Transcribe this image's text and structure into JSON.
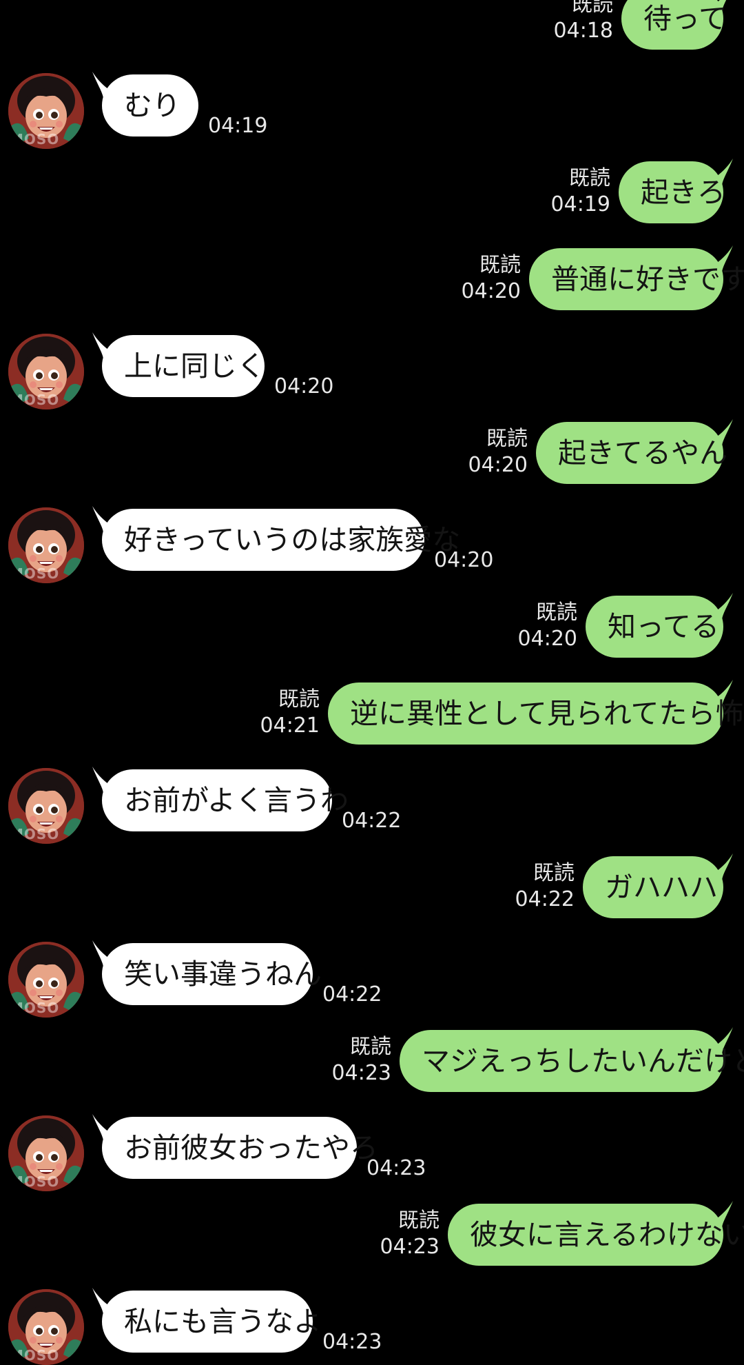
{
  "colors": {
    "background": "#000000",
    "outgoing_bubble": "#9fe184",
    "incoming_bubble": "#ffffff",
    "meta_text": "#e8e8e8"
  },
  "avatar": {
    "icon": "avatar-cartoon-girl-icon",
    "watermark": "MOSO"
  },
  "messages": [
    {
      "side": "out",
      "text": "待って",
      "read": "既読",
      "time": "04:18"
    },
    {
      "side": "in",
      "text": "むり",
      "time": "04:19"
    },
    {
      "side": "out",
      "text": "起きろ",
      "read": "既読",
      "time": "04:19"
    },
    {
      "side": "out",
      "text": "普通に好きです",
      "read": "既読",
      "time": "04:20"
    },
    {
      "side": "in",
      "text": "上に同じく",
      "time": "04:20"
    },
    {
      "side": "out",
      "text": "起きてるやん",
      "read": "既読",
      "time": "04:20"
    },
    {
      "side": "in",
      "text": "好きっていうのは家族愛な",
      "time": "04:20"
    },
    {
      "side": "out",
      "text": "知ってる",
      "read": "既読",
      "time": "04:20"
    },
    {
      "side": "out",
      "text": "逆に異性として見られてたら怖い",
      "read": "既読",
      "time": "04:21"
    },
    {
      "side": "in",
      "text": "お前がよく言うわ",
      "time": "04:22"
    },
    {
      "side": "out",
      "text": "ガハハハ",
      "read": "既読",
      "time": "04:22"
    },
    {
      "side": "in",
      "text": "笑い事違うねん",
      "time": "04:22"
    },
    {
      "side": "out",
      "text": "マジえっちしたいんだけど",
      "read": "既読",
      "time": "04:23"
    },
    {
      "side": "in",
      "text": "お前彼女おったやろ",
      "time": "04:23"
    },
    {
      "side": "out",
      "text": "彼女に言えるわけない",
      "read": "既読",
      "time": "04:23"
    },
    {
      "side": "in",
      "text": "私にも言うなよ",
      "time": "04:23"
    }
  ]
}
